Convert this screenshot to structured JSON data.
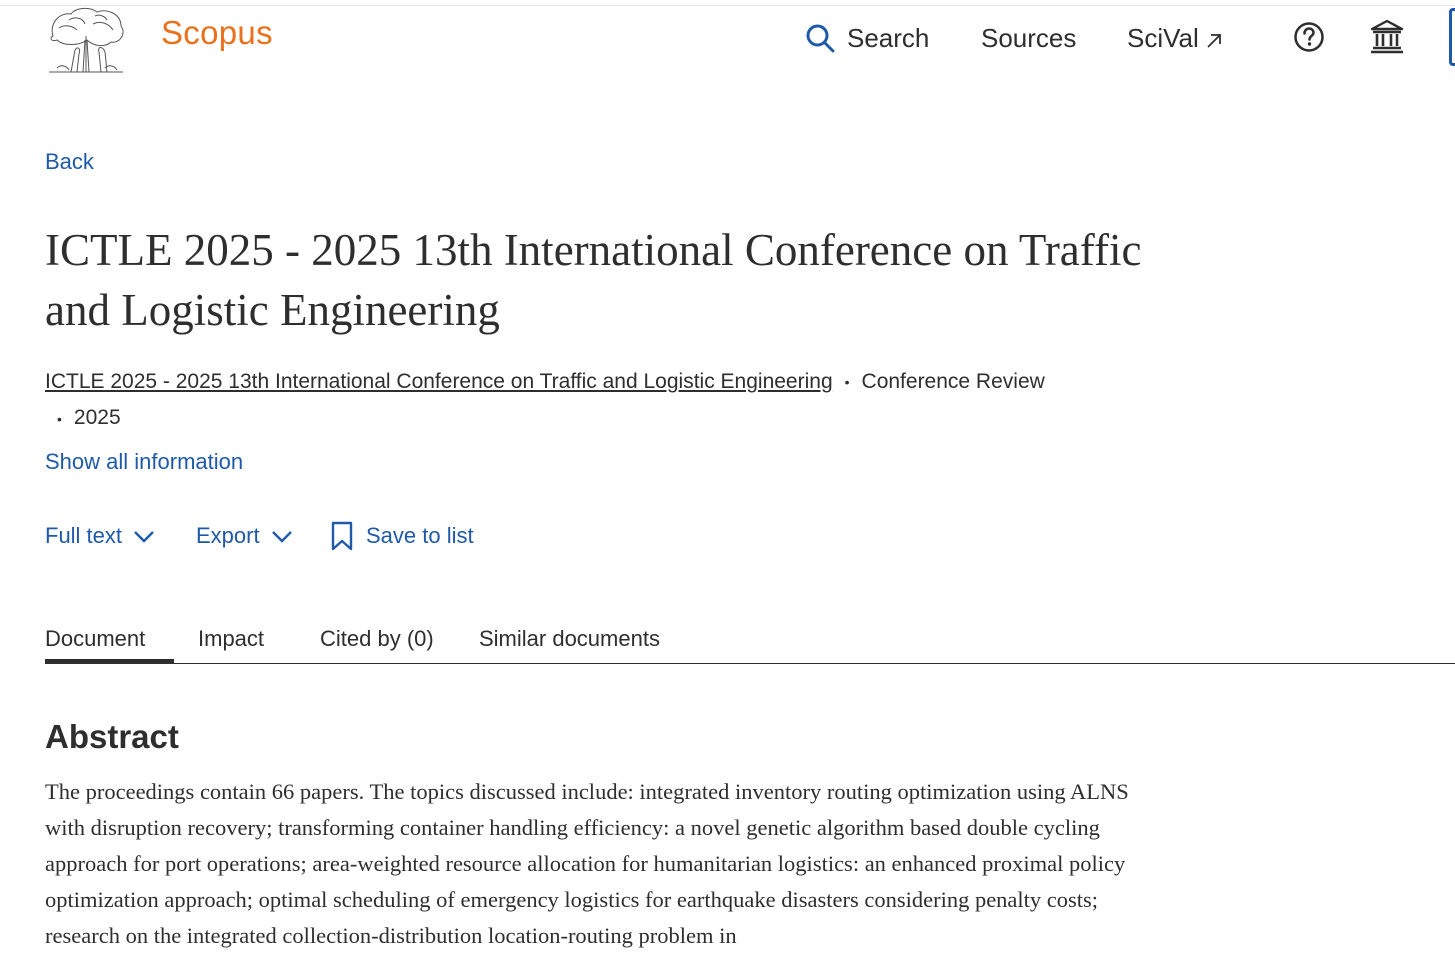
{
  "header": {
    "brand": "Scopus",
    "nav": {
      "search": "Search",
      "sources": "Sources",
      "scival": "SciVal"
    },
    "icons": [
      "elsevier-tree-logo",
      "search-icon",
      "external-link-icon",
      "help-icon",
      "institution-icon"
    ]
  },
  "back_label": "Back",
  "document": {
    "title": "ICTLE 2025 - 2025 13th International Conference on Traffic and Logistic Engineering",
    "source_title": "ICTLE 2025 - 2025 13th International Conference on Traffic and Logistic Engineering",
    "doc_type": "Conference Review",
    "year": "2025"
  },
  "show_all_label": "Show all information",
  "actions": {
    "full_text": "Full text",
    "export": "Export",
    "save_to_list": "Save to list"
  },
  "tabs": {
    "document": "Document",
    "impact": "Impact",
    "cited_by": "Cited by (0)",
    "similar": "Similar documents"
  },
  "abstract": {
    "heading": "Abstract",
    "text": "The proceedings contain 66 papers. The topics discussed include: integrated inventory routing optimization using ALNS with disruption recovery; transforming container handling efficiency: a novel genetic algorithm based double cycling approach for port operations; area-weighted resource allocation for humanitarian logistics: an enhanced proximal policy optimization approach; optimal scheduling of emergency logistics for earthquake disasters considering penalty costs; research on the integrated collection-distribution location-routing problem in"
  },
  "colors": {
    "brand_orange": "#e9711c",
    "link_blue": "#1f5aa8",
    "text": "#2e2e2e"
  }
}
